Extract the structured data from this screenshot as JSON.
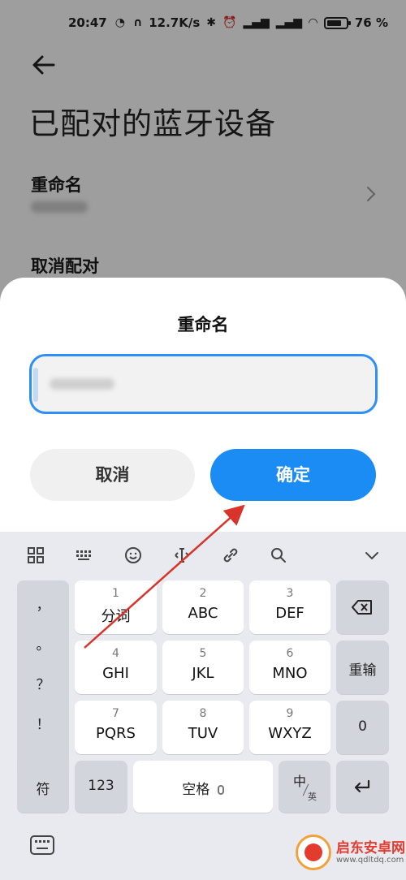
{
  "status_bar": {
    "time": "20:47",
    "net_speed": "12.7K/s",
    "battery": "76",
    "battery_level": 0.76
  },
  "settings_page": {
    "title": "已配对的蓝牙设备",
    "rename_label": "重命名",
    "unpair_label": "取消配对"
  },
  "dialog": {
    "title": "重命名",
    "input_value": "",
    "cancel_label": "取消",
    "confirm_label": "确定",
    "accent_color": "#1a8cf3"
  },
  "keyboard": {
    "toolbar_icons": [
      "grid-icon",
      "keyboard-layout-icon",
      "emoji-icon",
      "cursor-move-icon",
      "link-icon",
      "search-icon",
      "collapse-icon"
    ],
    "punctuation": [
      "，",
      "。",
      "？",
      "！"
    ],
    "keys": [
      {
        "num": "1",
        "letters": "分词"
      },
      {
        "num": "2",
        "letters": "ABC"
      },
      {
        "num": "3",
        "letters": "DEF"
      },
      {
        "num": "4",
        "letters": "GHI"
      },
      {
        "num": "5",
        "letters": "JKL"
      },
      {
        "num": "6",
        "letters": "MNO"
      },
      {
        "num": "7",
        "letters": "PQRS"
      },
      {
        "num": "8",
        "letters": "TUV"
      },
      {
        "num": "9",
        "letters": "WXYZ"
      }
    ],
    "retype_label": "重输",
    "zero_label": "0",
    "symbols_label": "符",
    "numbers_label": "123",
    "space_label": "空格",
    "lang_main": "中",
    "lang_alt": "英"
  },
  "watermark": {
    "title": "启东安卓网",
    "url": "www.qdltdq.com"
  }
}
